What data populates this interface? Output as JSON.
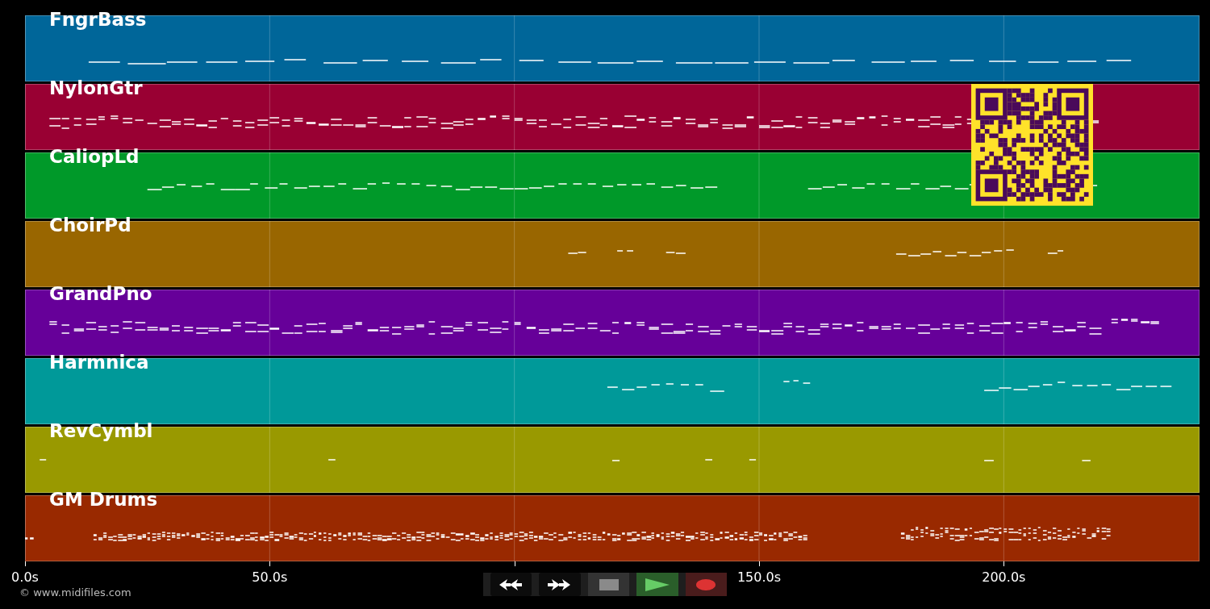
{
  "tracks": [
    {
      "name": "FngrBass",
      "color": "#006699"
    },
    {
      "name": "NylonGtr",
      "color": "#990033"
    },
    {
      "name": "CaliopLd",
      "color": "#009929"
    },
    {
      "name": "ChoirPd",
      "color": "#996600"
    },
    {
      "name": "GrandPno",
      "color": "#660099"
    },
    {
      "name": "Harmnica",
      "color": "#009999"
    },
    {
      "name": "RevCymbl",
      "color": "#999900"
    },
    {
      "name": "GM Drums",
      "color": "#992900"
    }
  ],
  "axis": {
    "ticks": [
      "0.0s",
      "50.0s",
      "150.0s",
      "200.0s"
    ]
  },
  "transport": {
    "buttons": [
      {
        "kind": "rewind"
      },
      {
        "kind": "forward"
      },
      {
        "kind": "stop"
      },
      {
        "kind": "play"
      },
      {
        "kind": "record"
      }
    ]
  },
  "copyright": "© www.midifiles.com"
}
